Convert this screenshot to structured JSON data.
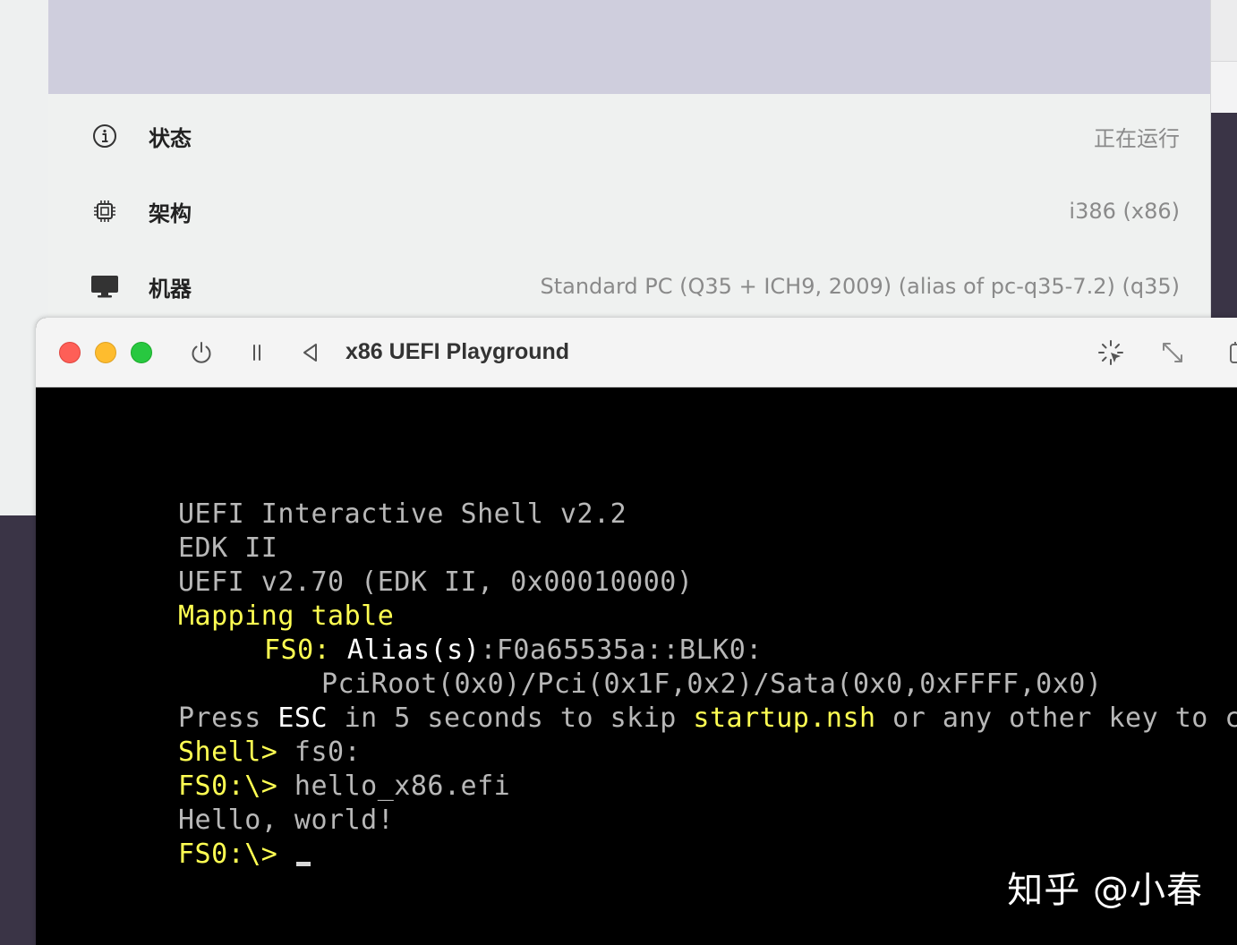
{
  "details": {
    "rows": [
      {
        "icon": "info-icon",
        "label": "状态",
        "value": "正在运行"
      },
      {
        "icon": "cpu-icon",
        "label": "架构",
        "value": "i386 (x86)"
      },
      {
        "icon": "monitor-icon",
        "label": "机器",
        "value": "Standard PC (Q35 + ICH9, 2009) (alias of pc-q35-7.2) (q35)"
      }
    ]
  },
  "vm_window": {
    "title": "x86 UEFI Playground",
    "toolbar_icons": [
      "power-icon",
      "pause-icon",
      "back-icon",
      "capture-cursor-icon",
      "resize-icon",
      "window-icon"
    ]
  },
  "terminal": {
    "line1": "UEFI Interactive Shell v2.2",
    "line2": "EDK II",
    "line3": "UEFI v2.70 (EDK II, 0x00010000)",
    "mapping": "Mapping table",
    "fs0_label": "FS0:",
    "alias": "Alias(s)",
    "alias_value": ":F0a65535a::BLK0:",
    "device_path": "PciRoot(0x0)/Pci(0x1F,0x2)/Sata(0x0,0xFFFF,0x0)",
    "press_1": "Press ",
    "press_esc": "ESC",
    "press_2": " in 5 seconds to skip ",
    "press_startup": "startup.nsh",
    "press_3": " or any other key to continue.",
    "prompt_shell": "Shell>",
    "cmd1": " fs0:",
    "prompt_fs0": "FS0:\\>",
    "cmd2": " hello_x86.efi",
    "output": "Hello, world!",
    "prompt_final": "FS0:\\>"
  },
  "watermark": "知乎 @小春",
  "colors": {
    "banner": "#cfcedd",
    "terminal_yellow": "#ffff52",
    "terminal_gray": "#b8b8b8"
  }
}
